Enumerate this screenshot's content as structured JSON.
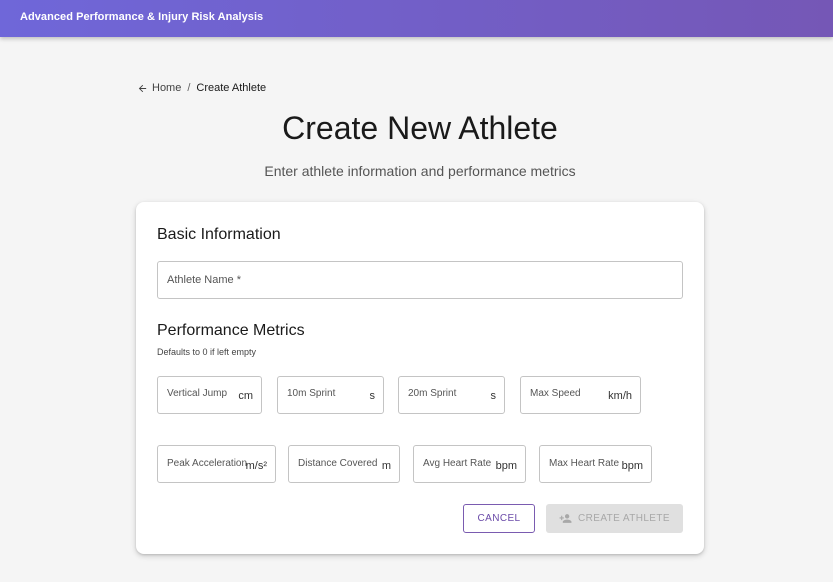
{
  "app": {
    "title": "Advanced Performance & Injury Risk Analysis"
  },
  "breadcrumb": {
    "home": "Home",
    "separator": "/",
    "current": "Create Athlete"
  },
  "page": {
    "title": "Create New Athlete",
    "subtitle": "Enter athlete information and performance metrics"
  },
  "basic": {
    "title": "Basic Information",
    "athlete_name": {
      "label": "Athlete Name *",
      "value": ""
    }
  },
  "metrics": {
    "title": "Performance Metrics",
    "hint": "Defaults to 0 if left empty",
    "fields": [
      {
        "label": "Vertical Jump",
        "unit": "cm",
        "value": ""
      },
      {
        "label": "10m Sprint",
        "unit": "s",
        "value": ""
      },
      {
        "label": "20m Sprint",
        "unit": "s",
        "value": ""
      },
      {
        "label": "Max Speed",
        "unit": "km/h",
        "value": ""
      },
      {
        "label": "Peak Acceleration",
        "unit": "m/s²",
        "value": ""
      },
      {
        "label": "Distance Covered",
        "unit": "m",
        "value": ""
      },
      {
        "label": "Avg Heart Rate",
        "unit": "bpm",
        "value": ""
      },
      {
        "label": "Max Heart Rate",
        "unit": "bpm",
        "value": ""
      }
    ]
  },
  "actions": {
    "cancel_label": "CANCEL",
    "create_label": "CREATE ATHLETE",
    "create_icon": "person-add-icon",
    "back_icon": "arrow-left-icon"
  },
  "colors": {
    "appbar_start": "#6f67d9",
    "appbar_end": "#7557b6",
    "accent": "#6a4aa8",
    "background": "#f5f5f5",
    "disabled": "#e0e0e0"
  }
}
